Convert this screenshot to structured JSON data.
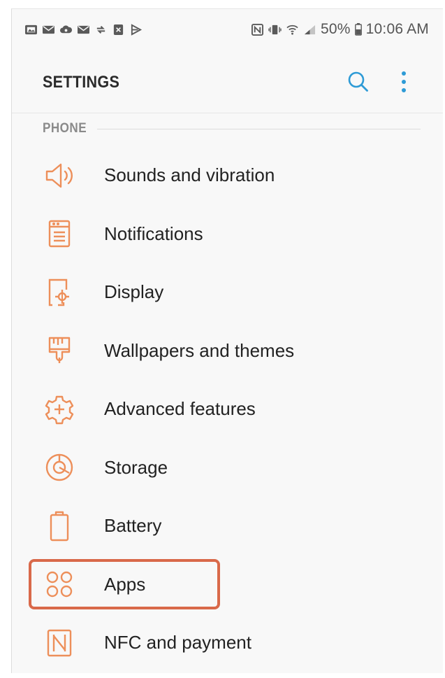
{
  "status_bar": {
    "left_icons": [
      "gallery-icon",
      "mail-icon",
      "cloud-icon",
      "mail-icon",
      "sync-icon",
      "clipboard-icon",
      "play-store-icon"
    ],
    "right_icons": [
      "nfc-icon",
      "vibrate-icon",
      "wifi-icon",
      "signal-icon"
    ],
    "battery": "50%",
    "time": "10:06 AM"
  },
  "header": {
    "title": "SETTINGS",
    "search_icon": "search-icon",
    "more_icon": "more-vertical-icon"
  },
  "section": {
    "label": "PHONE"
  },
  "items": [
    {
      "label": "Sounds and vibration",
      "icon": "speaker-icon"
    },
    {
      "label": "Notifications",
      "icon": "notifications-icon"
    },
    {
      "label": "Display",
      "icon": "display-icon"
    },
    {
      "label": "Wallpapers and themes",
      "icon": "paintbrush-icon"
    },
    {
      "label": "Advanced features",
      "icon": "gear-plus-icon"
    },
    {
      "label": "Storage",
      "icon": "storage-icon"
    },
    {
      "label": "Battery",
      "icon": "battery-icon"
    },
    {
      "label": "Apps",
      "icon": "apps-icon",
      "highlighted": true
    },
    {
      "label": "NFC and payment",
      "icon": "nfc-payment-icon"
    }
  ],
  "colors": {
    "accent": "#ed8f5a",
    "highlight_border": "#d9694a",
    "search_icon": "#2e9bd6",
    "background": "#f8f8f8"
  }
}
